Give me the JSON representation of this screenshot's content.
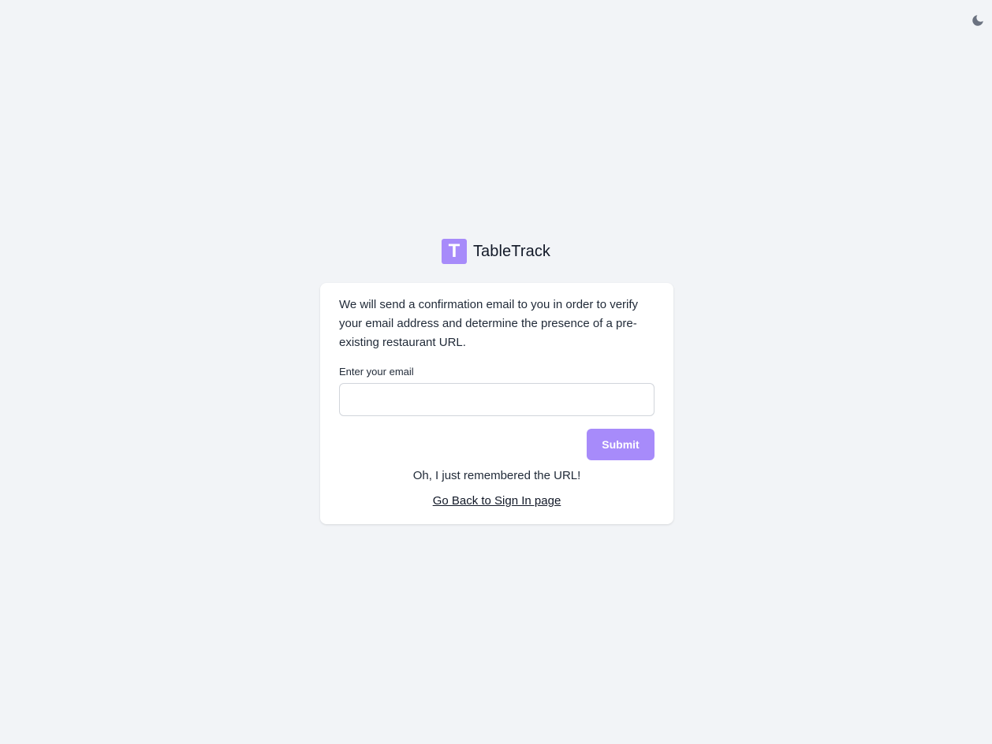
{
  "header": {
    "theme_toggle_icon": "moon-icon"
  },
  "brand": {
    "logo_letter": "T",
    "name": "TableTrack",
    "accent_color": "#a78bfa"
  },
  "form": {
    "intro_text": "We will send a confirmation email to you in order to verify your email address and determine the presence of a pre-existing restaurant URL.",
    "email_label": "Enter your email",
    "email_value": "",
    "email_placeholder": "",
    "submit_label": "Submit"
  },
  "footer": {
    "remember_text": "Oh, I just remembered the URL!",
    "back_link_label": "Go Back to Sign In page"
  }
}
